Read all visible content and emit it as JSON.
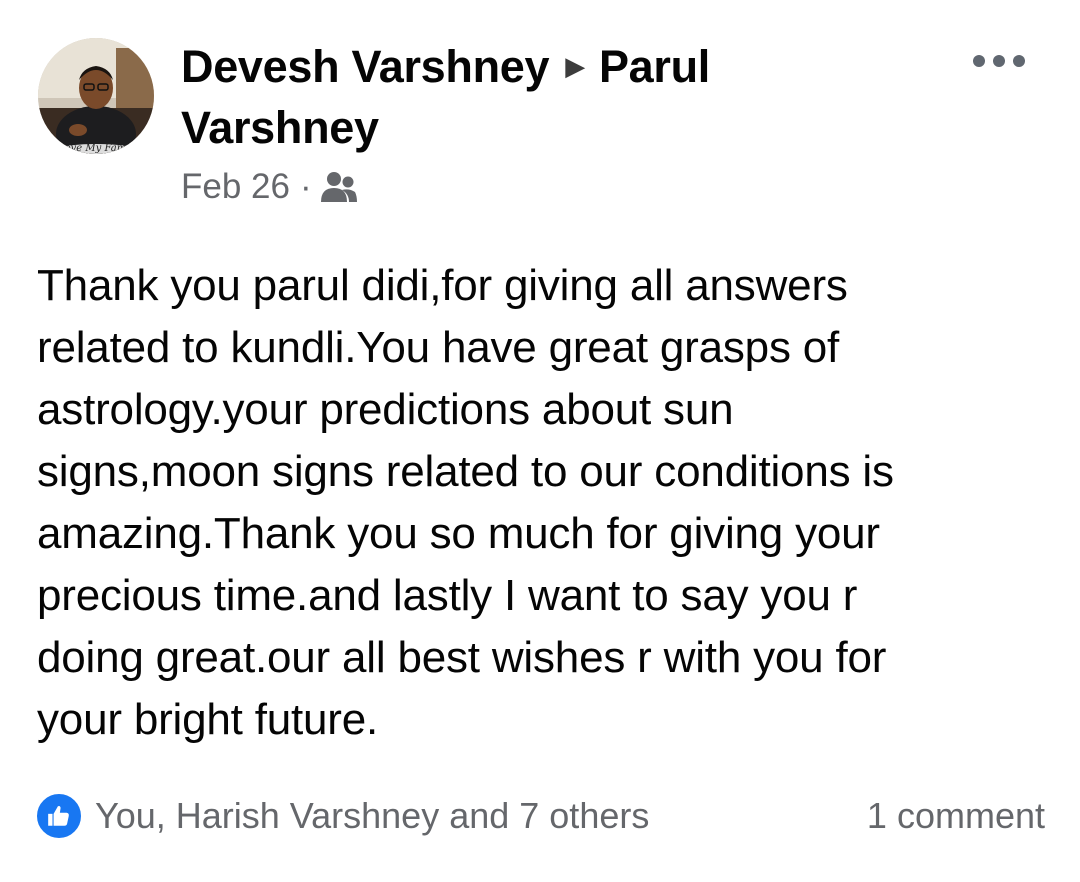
{
  "post": {
    "author": "Devesh Varshney",
    "recipient": "Parul Varshney",
    "date": "Feb 26",
    "separator": "·",
    "audience_icon": "friends-icon",
    "avatar_caption": "Love My Family",
    "body": "Thank you parul didi,for giving all answers\nrelated to kundli.You have great grasps of\nastrology.your predictions about sun\nsigns,moon signs related to our conditions is\namazing.Thank you so much for giving your\nprecious time.and lastly I want to say you r\ndoing great.our all best wishes r with you for\nyour bright future.",
    "reactions_text": "You, Harish Varshney and 7 others",
    "comments_text": "1 comment",
    "like_icon": "thumbs-up-icon",
    "more_icon": "more-options-icon"
  },
  "colors": {
    "like_blue": "#1877f2",
    "secondary_text": "#65676b",
    "primary_text": "#050505"
  }
}
